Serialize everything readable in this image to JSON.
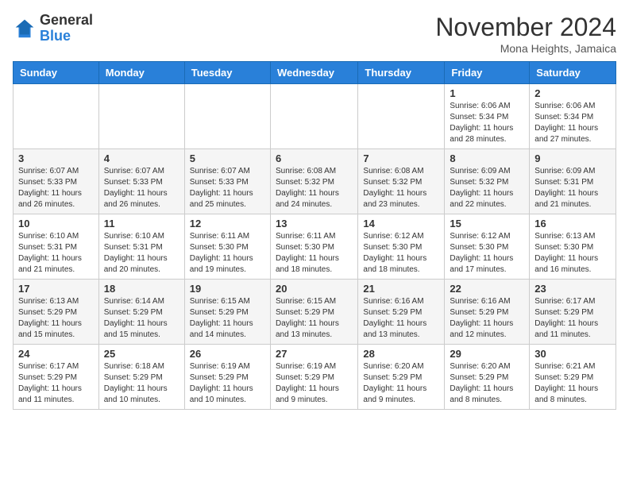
{
  "header": {
    "logo_general": "General",
    "logo_blue": "Blue",
    "month_title": "November 2024",
    "location": "Mona Heights, Jamaica"
  },
  "weekdays": [
    "Sunday",
    "Monday",
    "Tuesday",
    "Wednesday",
    "Thursday",
    "Friday",
    "Saturday"
  ],
  "weeks": [
    [
      {
        "day": "",
        "info": ""
      },
      {
        "day": "",
        "info": ""
      },
      {
        "day": "",
        "info": ""
      },
      {
        "day": "",
        "info": ""
      },
      {
        "day": "",
        "info": ""
      },
      {
        "day": "1",
        "info": "Sunrise: 6:06 AM\nSunset: 5:34 PM\nDaylight: 11 hours and 28 minutes."
      },
      {
        "day": "2",
        "info": "Sunrise: 6:06 AM\nSunset: 5:34 PM\nDaylight: 11 hours and 27 minutes."
      }
    ],
    [
      {
        "day": "3",
        "info": "Sunrise: 6:07 AM\nSunset: 5:33 PM\nDaylight: 11 hours and 26 minutes."
      },
      {
        "day": "4",
        "info": "Sunrise: 6:07 AM\nSunset: 5:33 PM\nDaylight: 11 hours and 26 minutes."
      },
      {
        "day": "5",
        "info": "Sunrise: 6:07 AM\nSunset: 5:33 PM\nDaylight: 11 hours and 25 minutes."
      },
      {
        "day": "6",
        "info": "Sunrise: 6:08 AM\nSunset: 5:32 PM\nDaylight: 11 hours and 24 minutes."
      },
      {
        "day": "7",
        "info": "Sunrise: 6:08 AM\nSunset: 5:32 PM\nDaylight: 11 hours and 23 minutes."
      },
      {
        "day": "8",
        "info": "Sunrise: 6:09 AM\nSunset: 5:32 PM\nDaylight: 11 hours and 22 minutes."
      },
      {
        "day": "9",
        "info": "Sunrise: 6:09 AM\nSunset: 5:31 PM\nDaylight: 11 hours and 21 minutes."
      }
    ],
    [
      {
        "day": "10",
        "info": "Sunrise: 6:10 AM\nSunset: 5:31 PM\nDaylight: 11 hours and 21 minutes."
      },
      {
        "day": "11",
        "info": "Sunrise: 6:10 AM\nSunset: 5:31 PM\nDaylight: 11 hours and 20 minutes."
      },
      {
        "day": "12",
        "info": "Sunrise: 6:11 AM\nSunset: 5:30 PM\nDaylight: 11 hours and 19 minutes."
      },
      {
        "day": "13",
        "info": "Sunrise: 6:11 AM\nSunset: 5:30 PM\nDaylight: 11 hours and 18 minutes."
      },
      {
        "day": "14",
        "info": "Sunrise: 6:12 AM\nSunset: 5:30 PM\nDaylight: 11 hours and 18 minutes."
      },
      {
        "day": "15",
        "info": "Sunrise: 6:12 AM\nSunset: 5:30 PM\nDaylight: 11 hours and 17 minutes."
      },
      {
        "day": "16",
        "info": "Sunrise: 6:13 AM\nSunset: 5:30 PM\nDaylight: 11 hours and 16 minutes."
      }
    ],
    [
      {
        "day": "17",
        "info": "Sunrise: 6:13 AM\nSunset: 5:29 PM\nDaylight: 11 hours and 15 minutes."
      },
      {
        "day": "18",
        "info": "Sunrise: 6:14 AM\nSunset: 5:29 PM\nDaylight: 11 hours and 15 minutes."
      },
      {
        "day": "19",
        "info": "Sunrise: 6:15 AM\nSunset: 5:29 PM\nDaylight: 11 hours and 14 minutes."
      },
      {
        "day": "20",
        "info": "Sunrise: 6:15 AM\nSunset: 5:29 PM\nDaylight: 11 hours and 13 minutes."
      },
      {
        "day": "21",
        "info": "Sunrise: 6:16 AM\nSunset: 5:29 PM\nDaylight: 11 hours and 13 minutes."
      },
      {
        "day": "22",
        "info": "Sunrise: 6:16 AM\nSunset: 5:29 PM\nDaylight: 11 hours and 12 minutes."
      },
      {
        "day": "23",
        "info": "Sunrise: 6:17 AM\nSunset: 5:29 PM\nDaylight: 11 hours and 11 minutes."
      }
    ],
    [
      {
        "day": "24",
        "info": "Sunrise: 6:17 AM\nSunset: 5:29 PM\nDaylight: 11 hours and 11 minutes."
      },
      {
        "day": "25",
        "info": "Sunrise: 6:18 AM\nSunset: 5:29 PM\nDaylight: 11 hours and 10 minutes."
      },
      {
        "day": "26",
        "info": "Sunrise: 6:19 AM\nSunset: 5:29 PM\nDaylight: 11 hours and 10 minutes."
      },
      {
        "day": "27",
        "info": "Sunrise: 6:19 AM\nSunset: 5:29 PM\nDaylight: 11 hours and 9 minutes."
      },
      {
        "day": "28",
        "info": "Sunrise: 6:20 AM\nSunset: 5:29 PM\nDaylight: 11 hours and 9 minutes."
      },
      {
        "day": "29",
        "info": "Sunrise: 6:20 AM\nSunset: 5:29 PM\nDaylight: 11 hours and 8 minutes."
      },
      {
        "day": "30",
        "info": "Sunrise: 6:21 AM\nSunset: 5:29 PM\nDaylight: 11 hours and 8 minutes."
      }
    ]
  ]
}
